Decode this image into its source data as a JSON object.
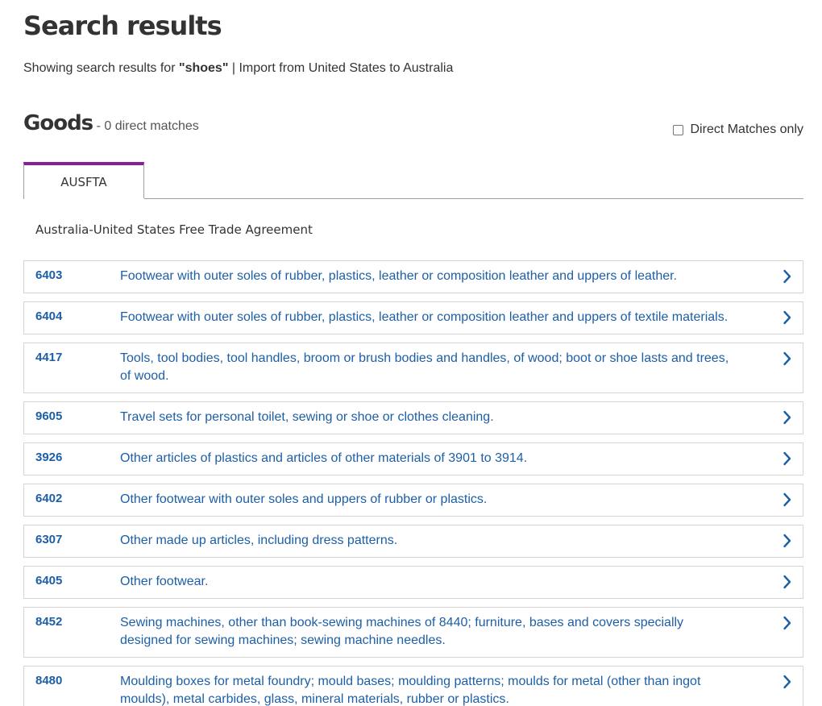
{
  "page": {
    "title": "Search results",
    "summary_prefix": "Showing search results for ",
    "search_term": "\"shoes\"",
    "summary_suffix": " | Import from United States to Australia"
  },
  "goods": {
    "title": "Goods",
    "count_text": " - 0 direct matches",
    "direct_matches_label": "Direct Matches only",
    "direct_matches_checked": false
  },
  "tabs": [
    {
      "label": "AUSFTA",
      "active": true
    }
  ],
  "agreement": {
    "title": "Australia-United States Free Trade Agreement"
  },
  "results": [
    {
      "code": "6403",
      "description": "Footwear with outer soles of rubber, plastics, leather or composition leather and uppers of leather."
    },
    {
      "code": "6404",
      "description": "Footwear with outer soles of rubber, plastics, leather or composition leather and uppers of textile materials."
    },
    {
      "code": "4417",
      "description": "Tools, tool bodies, tool handles, broom or brush bodies and handles, of wood; boot or shoe lasts and trees, of wood."
    },
    {
      "code": "9605",
      "description": "Travel sets for personal toilet, sewing or shoe or clothes cleaning."
    },
    {
      "code": "3926",
      "description": "Other articles of plastics and articles of other materials of 3901 to 3914."
    },
    {
      "code": "6402",
      "description": "Other footwear with outer soles and uppers of rubber or plastics."
    },
    {
      "code": "6307",
      "description": "Other made up articles, including dress patterns."
    },
    {
      "code": "6405",
      "description": "Other footwear."
    },
    {
      "code": "8452",
      "description": "Sewing machines, other than book-sewing machines of 8440; furniture, bases and covers specially designed for sewing machines; sewing machine needles."
    },
    {
      "code": "8480",
      "description": "Moulding boxes for metal foundry; mould bases; moulding patterns; moulds for metal (other than ingot moulds), metal carbides, glass, mineral materials, rubber or plastics."
    }
  ],
  "colors": {
    "accent_tab": "#8a1d9b",
    "link": "#1d5fa6",
    "text": "#333333"
  },
  "icons": {
    "row_action": "chevron-right-icon"
  }
}
